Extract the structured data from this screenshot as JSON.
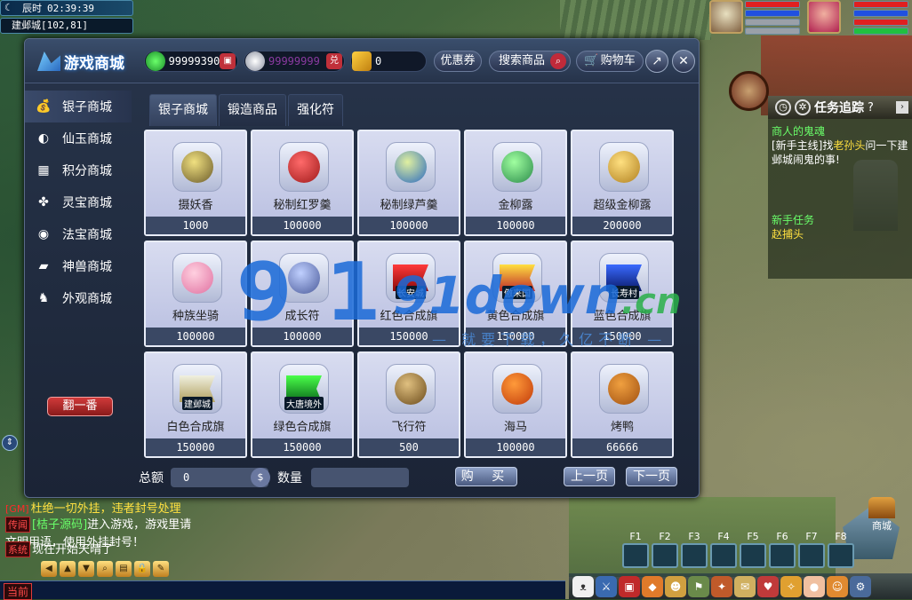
{
  "hud": {
    "time_label": "辰时",
    "time_value": "02:39:39",
    "location": "建邺城[102,81]"
  },
  "quest_tracker": {
    "title": "任务追踪",
    "line1": "商人的鬼魂",
    "line2_prefix": "[新手主线]找",
    "line2_npc": "老孙头",
    "line2_suffix": "问一下建邺城闹鬼的事!",
    "sub_title": "新手任务",
    "sub_npc": "赵捕头"
  },
  "shop": {
    "title": "游戏商城",
    "currency": {
      "fairy_jade": "99999390",
      "silver": "99999999",
      "silver_exchange": "兑",
      "coupon_count": "0"
    },
    "buttons": {
      "coupon": "优惠券",
      "search": "搜索商品",
      "cart": "购物车",
      "buy": "购 买",
      "prev": "上一页",
      "next": "下一页",
      "lottery": "翻一番"
    },
    "sidebar": [
      {
        "label": "银子商城",
        "icon": "money-bag-icon",
        "glyph": "💰"
      },
      {
        "label": "仙玉商城",
        "icon": "jade-icon",
        "glyph": "◐"
      },
      {
        "label": "积分商城",
        "icon": "gift-icon",
        "glyph": "▦"
      },
      {
        "label": "灵宝商城",
        "icon": "clover-icon",
        "glyph": "✤"
      },
      {
        "label": "法宝商城",
        "icon": "orb-icon",
        "glyph": "◉"
      },
      {
        "label": "神兽商城",
        "icon": "beast-icon",
        "glyph": "▰"
      },
      {
        "label": "外观商城",
        "icon": "clothes-icon",
        "glyph": "♞"
      }
    ],
    "tabs": [
      "银子商城",
      "锻造商品",
      "强化符"
    ],
    "items": [
      {
        "name": "摄妖香",
        "price": "1000",
        "icon": "incense-coil-icon",
        "color1": "#f0e080",
        "color2": "#6a5a2a",
        "flag_label": ""
      },
      {
        "name": "秘制红罗羹",
        "price": "100000",
        "icon": "red-soup-bowl-icon",
        "color1": "#ff6a6a",
        "color2": "#a01a1a",
        "flag_label": ""
      },
      {
        "name": "秘制绿芦羹",
        "price": "100000",
        "icon": "green-soup-bowl-icon",
        "color1": "#e0f0a0",
        "color2": "#2a6ac0",
        "flag_label": ""
      },
      {
        "name": "金柳露",
        "price": "100000",
        "icon": "green-gourd-icon",
        "color1": "#a0ffa0",
        "color2": "#2a8a4a",
        "flag_label": ""
      },
      {
        "name": "超级金柳露",
        "price": "200000",
        "icon": "gold-gourd-icon",
        "color1": "#ffe080",
        "color2": "#b08020",
        "flag_label": ""
      },
      {
        "name": "种族坐骑",
        "price": "100000",
        "icon": "pink-pig-mount-icon",
        "color1": "#ffd0e0",
        "color2": "#e070a0",
        "flag_label": ""
      },
      {
        "name": "成长符",
        "price": "100000",
        "icon": "scroll-icon",
        "color1": "#c0d0ff",
        "color2": "#4a5a9a",
        "flag_label": ""
      },
      {
        "name": "红色合成旗",
        "price": "150000",
        "icon": "red-flag-icon",
        "color1": "#ff3a3a",
        "color2": "#8a0a0a",
        "flag_label": "长安城"
      },
      {
        "name": "黄色合成旗",
        "price": "150000",
        "icon": "yellow-flag-icon",
        "color1": "#ffe040",
        "color2": "#c02a2a",
        "flag_label": "傲来国"
      },
      {
        "name": "蓝色合成旗",
        "price": "150000",
        "icon": "blue-flag-icon",
        "color1": "#3a6aff",
        "color2": "#0a1a6a",
        "flag_label": "长寿村"
      },
      {
        "name": "白色合成旗",
        "price": "150000",
        "icon": "white-flag-icon",
        "color1": "#f0f0e0",
        "color2": "#b0a060",
        "flag_label": "建邺城"
      },
      {
        "name": "绿色合成旗",
        "price": "150000",
        "icon": "green-flag-icon",
        "color1": "#4aff4a",
        "color2": "#0a6a1a",
        "flag_label": "大唐境外"
      },
      {
        "name": "飞行符",
        "price": "500",
        "icon": "flying-talisman-icon",
        "color1": "#e0c080",
        "color2": "#6a4a1a",
        "flag_label": ""
      },
      {
        "name": "海马",
        "price": "100000",
        "icon": "seahorse-icon",
        "color1": "#ff9a3a",
        "color2": "#c03a0a",
        "flag_label": ""
      },
      {
        "name": "烤鸭",
        "price": "66666",
        "icon": "roast-duck-icon",
        "color1": "#f0a040",
        "color2": "#a05010",
        "flag_label": ""
      }
    ],
    "footer": {
      "total_label": "总额",
      "total_value": "0",
      "qty_label": "数量",
      "qty_value": ""
    }
  },
  "watermark": {
    "nine": "9",
    "one": "1",
    "text": "91down",
    "cn": ".cn",
    "slogan": "— 就要下载，久亿不断 —"
  },
  "chat": {
    "gm_tag": "[GM]",
    "gm_msg": "杜绝一切外挂，违者封号处理",
    "rumor_tag": "传闻",
    "rumor_name": "[桔子源码]",
    "rumor_msg": "进入游戏，游戏里请文明用语，使用外挂封号！",
    "system_tag": "系统",
    "system_msg": "现在开始天晴了",
    "channel": "当前"
  },
  "hotkeys": [
    "F1",
    "F2",
    "F3",
    "F4",
    "F5",
    "F6",
    "F7",
    "F8"
  ],
  "city_button": "商城",
  "colors": {
    "accent_red": "#c0303a",
    "panel_bg": "#27344a",
    "item_card": "#d8dcf0",
    "price_bar": "#3a4864"
  }
}
